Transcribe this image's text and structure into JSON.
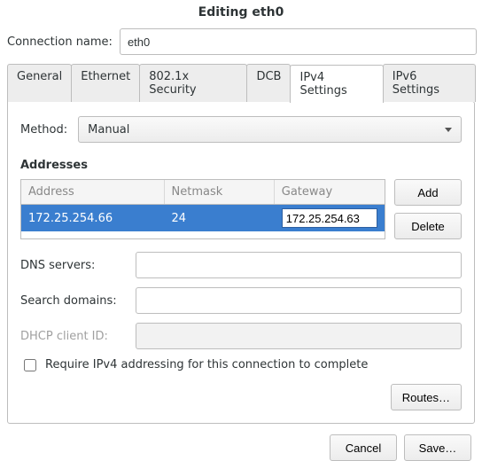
{
  "title": "Editing eth0",
  "connection_name_label": "Connection name:",
  "connection_name_value": "eth0",
  "tabs": {
    "general": "General",
    "ethernet": "Ethernet",
    "security": "802.1x Security",
    "dcb": "DCB",
    "ipv4": "IPv4 Settings",
    "ipv6": "IPv6 Settings"
  },
  "method_label": "Method:",
  "method_value": "Manual",
  "addresses_label": "Addresses",
  "addr_headers": {
    "address": "Address",
    "netmask": "Netmask",
    "gateway": "Gateway"
  },
  "addr_row": {
    "address": "172.25.254.66",
    "netmask": "24",
    "gateway": "172.25.254.63"
  },
  "buttons": {
    "add": "Add",
    "delete": "Delete",
    "routes": "Routes…",
    "cancel": "Cancel",
    "save": "Save…"
  },
  "dns_label": "DNS servers:",
  "dns_value": "",
  "search_label": "Search domains:",
  "search_value": "",
  "dhcp_label": "DHCP client ID:",
  "dhcp_value": "",
  "require_label": "Require IPv4 addressing for this connection to complete"
}
